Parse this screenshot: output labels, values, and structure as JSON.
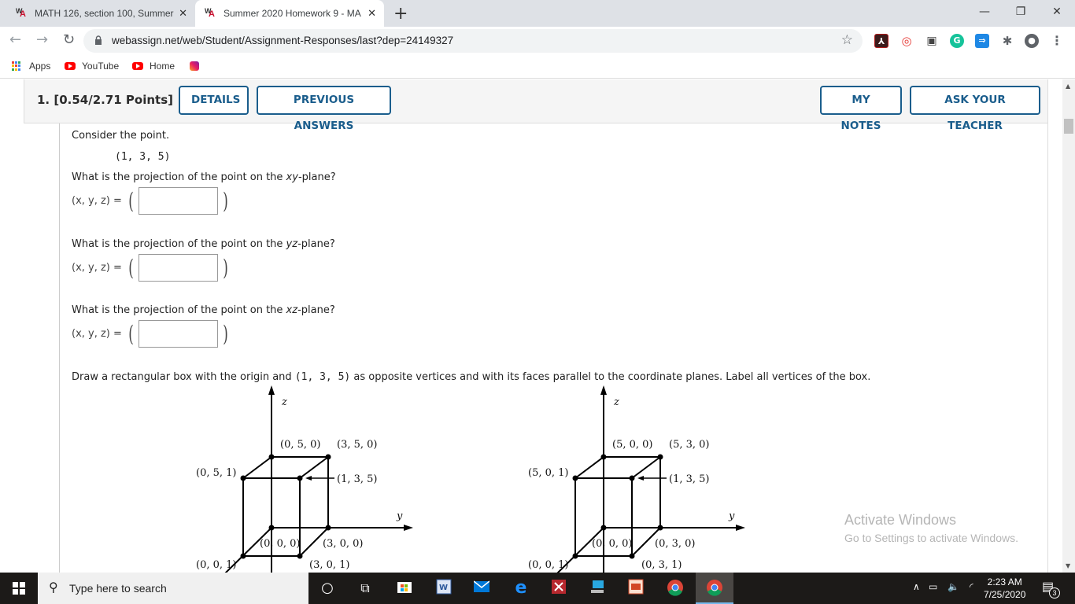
{
  "browser": {
    "tabs": [
      {
        "label": "MATH 126, section 100, Summer",
        "favicon": "webassign-icon",
        "active": false
      },
      {
        "label": "Summer 2020 Homework 9 - MA",
        "favicon": "webassign-icon",
        "active": true
      }
    ],
    "new_tab_label": "+",
    "url": "webassign.net/web/Student/Assignment-Responses/last?dep=24149327",
    "bookmarks": [
      {
        "label": "Apps",
        "icon": "apps-grid-icon"
      },
      {
        "label": "YouTube",
        "icon": "youtube-icon"
      },
      {
        "label": "Home",
        "icon": "youtube-icon"
      },
      {
        "label": "",
        "icon": "instagram-icon"
      }
    ],
    "window_controls": {
      "minimize": "—",
      "restore": "❐",
      "close": "✕"
    }
  },
  "question": {
    "number_points": "1.  [0.54/2.71 Points]",
    "buttons": {
      "details": "DETAILS",
      "previous_answers": "PREVIOUS ANSWERS",
      "my_notes": "MY NOTES",
      "ask_teacher": "ASK YOUR TEACHER"
    },
    "intro": "Consider the point.",
    "point": "(1, 3, 5)",
    "parts": [
      {
        "prefix": "What is the projection of the point on the ",
        "plane": "xy",
        "suffix": "-plane?",
        "label": "(x, y, z) =",
        "value": ""
      },
      {
        "prefix": "What is the projection of the point on the ",
        "plane": "yz",
        "suffix": "-plane?",
        "label": "(x, y, z) =",
        "value": ""
      },
      {
        "prefix": "What is the projection of the point on the ",
        "plane": "xz",
        "suffix": "-plane?",
        "label": "(x, y, z) =",
        "value": ""
      }
    ],
    "draw_prompt_a": "Draw a rectangular box with the origin and ",
    "draw_prompt_point": "(1, 3, 5)",
    "draw_prompt_b": " as opposite vertices and with its faces parallel to the coordinate planes. Label all vertices of the box.",
    "graphs": [
      {
        "axis_z": "z",
        "axis_y": "y",
        "labels": {
          "top_back_left": "(0, 5, 0)",
          "top_back_right": "(3, 5, 0)",
          "top_front_left": "(0, 5, 1)",
          "top_front_right": "(1, 3, 5)",
          "bottom_back_left": "(0, 0, 0)",
          "bottom_back_right": "(3, 0, 0)",
          "bottom_front_left": "(0, 0, 1)",
          "bottom_front_right": "(3, 0, 1)"
        }
      },
      {
        "axis_z": "z",
        "axis_y": "y",
        "labels": {
          "top_back_left": "(5, 0, 0)",
          "top_back_right": "(5, 3, 0)",
          "top_front_left": "(5, 0, 1)",
          "top_front_right": "(1, 3, 5)",
          "bottom_back_left": "(0, 0, 0)",
          "bottom_back_right": "(0, 3, 0)",
          "bottom_front_left": "(0, 0, 1)",
          "bottom_front_right": "(0, 3, 1)"
        }
      }
    ]
  },
  "watermark": {
    "title": "Activate Windows",
    "subtitle": "Go to Settings to activate Windows."
  },
  "taskbar": {
    "search_placeholder": "Type here to search",
    "time": "2:23 AM",
    "date": "7/25/2020",
    "notification_count": "3"
  }
}
